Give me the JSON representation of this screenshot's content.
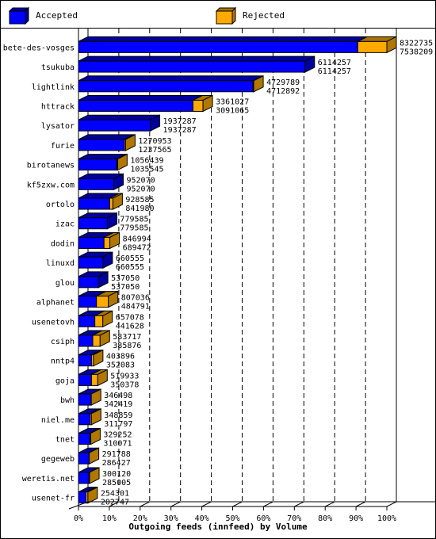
{
  "legend": {
    "accepted_label": "Accepted",
    "rejected_label": "Rejected"
  },
  "colors": {
    "accepted_front": "#0000ff",
    "accepted_top": "#00009c",
    "accepted_side": "#00009c",
    "rejected_front": "#ffaa00",
    "rejected_top": "#a87400",
    "rejected_side": "#b07800"
  },
  "chart_data": {
    "type": "bar",
    "orientation": "horizontal",
    "stacked": true,
    "title": "",
    "xlabel": "Outgoing feeds (innfeed) by Volume",
    "ylabel": "",
    "xlim": [
      0,
      100
    ],
    "x_ticks": [
      "0%",
      "10%",
      "20%",
      "30%",
      "40%",
      "50%",
      "60%",
      "70%",
      "80%",
      "90%",
      "100%"
    ],
    "grid": true,
    "legend_position": "top",
    "categories": [
      "bete-des-vosges",
      "tsukuba",
      "lightlink",
      "httrack",
      "lysator",
      "furie",
      "birotanews",
      "kf5zxw.com",
      "ortolo",
      "izac",
      "dodin",
      "linuxd",
      "glou",
      "alphanet",
      "usenetovh",
      "csiph",
      "nntp4",
      "goja",
      "bwh",
      "niel.me",
      "tnet",
      "gegeweb",
      "weretis.net",
      "usenet-fr"
    ],
    "totals": [
      8322735,
      6114257,
      4729789,
      3361027,
      1937287,
      1270953,
      1056439,
      952070,
      928585,
      779585,
      846994,
      660555,
      537050,
      807036,
      657078,
      583717,
      403896,
      519933,
      346498,
      348859,
      329252,
      291788,
      300120,
      254301
    ],
    "accepted": [
      7538209,
      6114257,
      4712892,
      3091065,
      1937287,
      1237565,
      1035545,
      952070,
      841980,
      779585,
      689472,
      660555,
      537050,
      484791,
      441628,
      385876,
      352083,
      350378,
      342419,
      311797,
      310071,
      286427,
      285005,
      202747
    ],
    "series": [
      {
        "name": "Accepted",
        "values": [
          7538209,
          6114257,
          4712892,
          3091065,
          1937287,
          1237565,
          1035545,
          952070,
          841980,
          779585,
          689472,
          660555,
          537050,
          484791,
          441628,
          385876,
          352083,
          350378,
          342419,
          311797,
          310071,
          286427,
          285005,
          202747
        ]
      },
      {
        "name": "Rejected",
        "values": [
          784526,
          0,
          16897,
          269962,
          0,
          33388,
          20894,
          0,
          86605,
          0,
          157522,
          0,
          0,
          322245,
          215450,
          197841,
          51813,
          169555,
          4079,
          37062,
          19181,
          5361,
          15115,
          51554
        ]
      }
    ]
  }
}
